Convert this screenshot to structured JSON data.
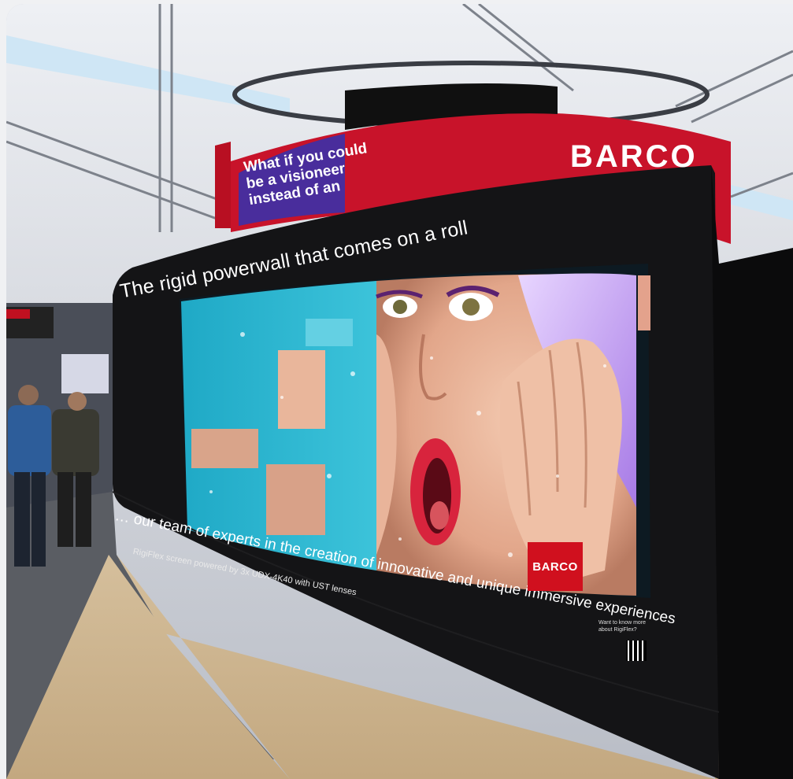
{
  "photo": {
    "sign": {
      "lines": [
        "What if you could",
        "be a visioneer",
        "instead of an"
      ]
    },
    "brand": "BARCO",
    "wall": {
      "title": "The rigid powerwall that comes on a roll",
      "description": "… our team of experts in the creation of innovative and unique immersive experiences",
      "caption": "RigiFlex screen powered by 3x UDX-4K40 with UST lenses",
      "screen_logo": "BARCO",
      "info_lines": [
        "Want to know more",
        "about RigiFlex?"
      ]
    },
    "colors": {
      "booth_red": "#c8132a",
      "wall_black": "#141416",
      "screen_cyan": "#2bb4cf",
      "floor_wood": "#cdb48f"
    }
  }
}
